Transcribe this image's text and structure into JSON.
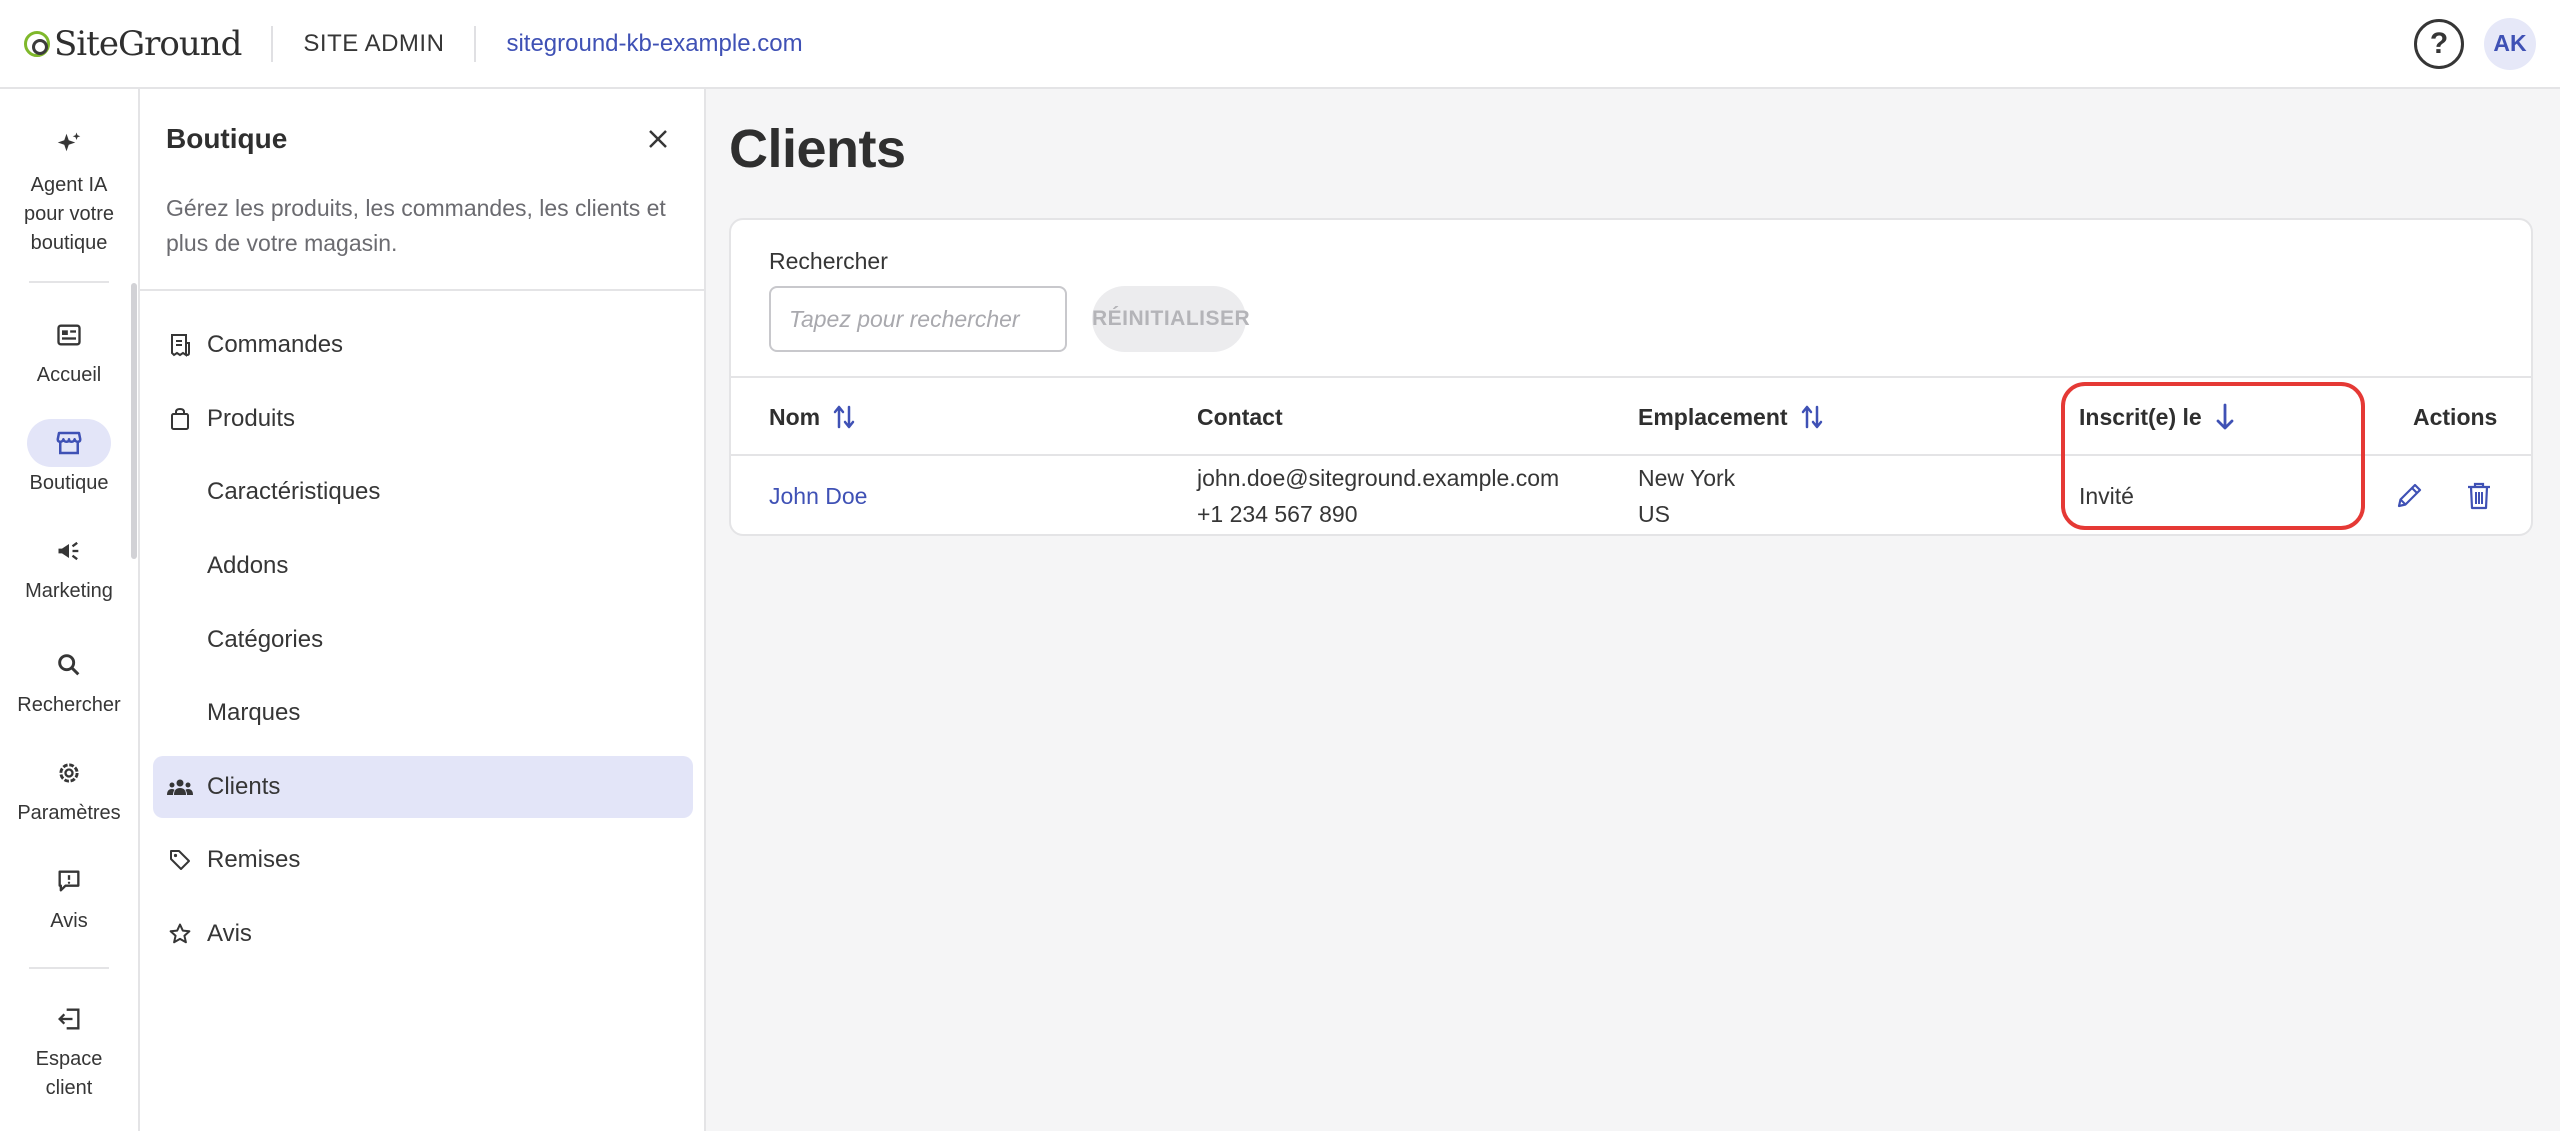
{
  "topbar": {
    "logo_text": "SiteGround",
    "section": "SITE ADMIN",
    "site_url": "siteground-kb-example.com",
    "help": "?",
    "avatar_initials": "AK"
  },
  "rail": {
    "items": [
      {
        "label": "Agent IA pour votre boutique",
        "icon": "sparkle-icon"
      },
      {
        "label": "Accueil",
        "icon": "dashboard-icon"
      },
      {
        "label": "Boutique",
        "icon": "store-icon"
      },
      {
        "label": "Marketing",
        "icon": "megaphone-icon"
      },
      {
        "label": "Rechercher",
        "icon": "search-icon"
      },
      {
        "label": "Paramètres",
        "icon": "gear-icon"
      },
      {
        "label": "Avis",
        "icon": "feedback-icon"
      },
      {
        "label": "Espace client",
        "icon": "exit-icon"
      }
    ],
    "active": "Boutique"
  },
  "panel": {
    "title": "Boutique",
    "description": "Gérez les produits, les commandes, les clients et plus de votre magasin.",
    "nav": [
      {
        "label": "Commandes",
        "icon": "receipt-icon"
      },
      {
        "label": "Produits",
        "icon": "bag-icon"
      },
      {
        "label": "Caractéristiques"
      },
      {
        "label": "Addons"
      },
      {
        "label": "Catégories"
      },
      {
        "label": "Marques"
      },
      {
        "label": "Clients",
        "icon": "users-icon"
      },
      {
        "label": "Remises",
        "icon": "tag-icon"
      },
      {
        "label": "Avis",
        "icon": "star-icon"
      }
    ],
    "active": "Clients"
  },
  "main": {
    "title": "Clients",
    "search": {
      "label": "Rechercher",
      "placeholder": "Tapez pour rechercher",
      "value": ""
    },
    "reset_label": "RÉINITIALISER",
    "table": {
      "columns": [
        "Nom",
        "Contact",
        "Emplacement",
        "Inscrit(e) le",
        "Actions"
      ],
      "sorted_column": "Inscrit(e) le",
      "sort_direction": "descending",
      "rows": [
        {
          "name": "John Doe",
          "email": "john.doe@siteground.example.com",
          "phone": "+1 234 567 890",
          "city": "New York",
          "country": "US",
          "registered": "Invité"
        }
      ]
    }
  },
  "colors": {
    "accent": "#3f51b5",
    "active_bg": "#e3e5f8",
    "highlight": "#e53935",
    "brand_green": "#7fb82b"
  }
}
